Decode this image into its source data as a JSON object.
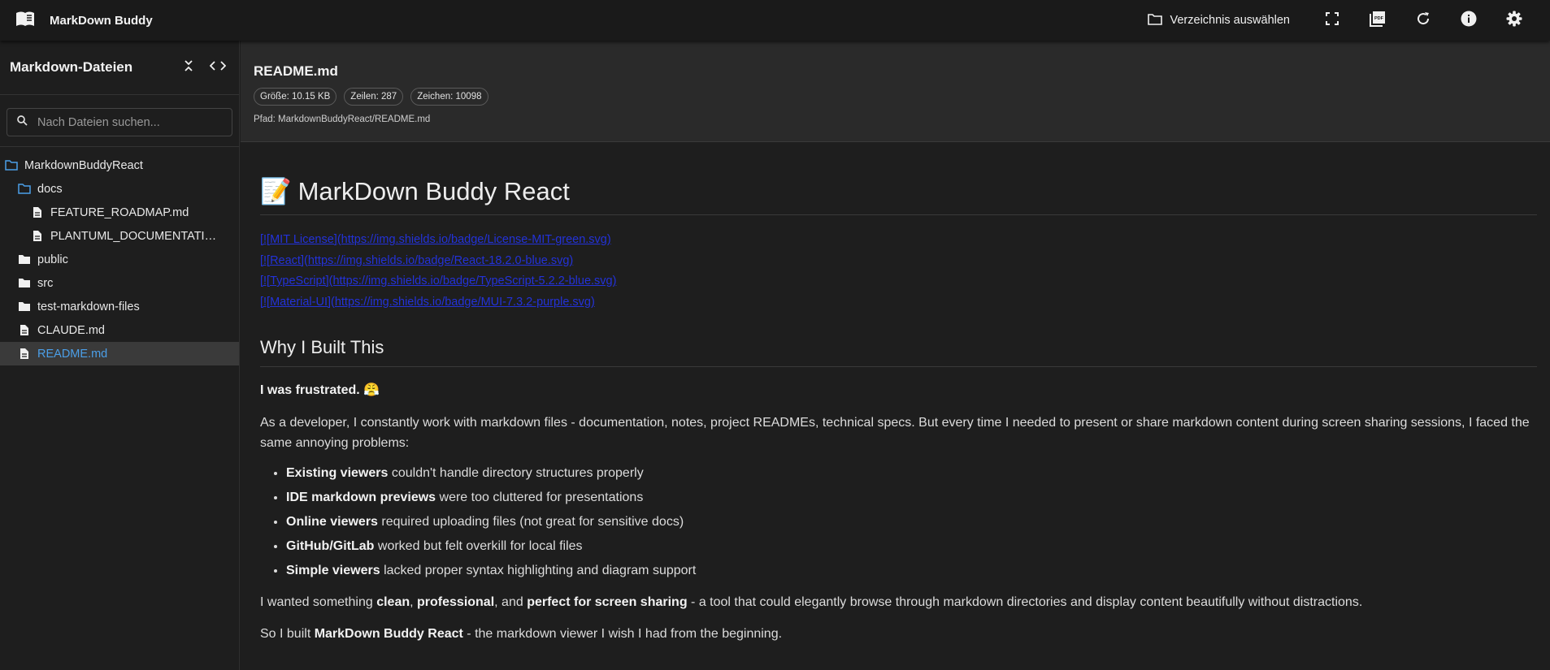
{
  "app": {
    "title": "MarkDown Buddy"
  },
  "toolbar": {
    "select_dir_label": "Verzeichnis auswählen",
    "icons": [
      "folder-icon",
      "fullscreen-icon",
      "pdf-icon",
      "refresh-icon",
      "info-icon",
      "settings-icon"
    ]
  },
  "sidebar": {
    "title": "Markdown-Dateien",
    "search_placeholder": "Nach Dateien suchen...",
    "items": [
      {
        "label": "MarkdownBuddyReact",
        "type": "folder-open",
        "level": 0
      },
      {
        "label": "docs",
        "type": "folder-open",
        "level": 1
      },
      {
        "label": "FEATURE_ROADMAP.md",
        "type": "file",
        "level": 2
      },
      {
        "label": "PLANTUML_DOCUMENTATION.md",
        "type": "file",
        "level": 2
      },
      {
        "label": "public",
        "type": "folder",
        "level": 1
      },
      {
        "label": "src",
        "type": "folder",
        "level": 1
      },
      {
        "label": "test-markdown-files",
        "type": "folder",
        "level": 1
      },
      {
        "label": "CLAUDE.md",
        "type": "file",
        "level": 1
      },
      {
        "label": "README.md",
        "type": "file",
        "level": 1,
        "active": true
      }
    ]
  },
  "file": {
    "name": "README.md",
    "size": "Größe: 10.15 KB",
    "lines": "Zeilen: 287",
    "chars": "Zeichen: 10098",
    "path": "Pfad: MarkdownBuddyReact/README.md"
  },
  "doc": {
    "h1_emoji": "📝",
    "h1": "MarkDown Buddy React",
    "links": [
      "[![MIT License](https://img.shields.io/badge/License-MIT-green.svg)",
      "[![React](https://img.shields.io/badge/React-18.2.0-blue.svg)",
      "[![TypeScript](https://img.shields.io/badge/TypeScript-5.2.2-blue.svg)",
      "[![Material-UI](https://img.shields.io/badge/MUI-7.3.2-purple.svg)"
    ],
    "h2": "Why I Built This",
    "frustrated": "I was frustrated. 😤",
    "intro": "As a developer, I constantly work with markdown files - documentation, notes, project READMEs, technical specs. But every time I needed to present or share markdown content during screen sharing sessions, I faced the same annoying problems:",
    "bullets": [
      {
        "bold": "Existing viewers",
        "text": " couldn't handle directory structures properly"
      },
      {
        "bold": "IDE markdown previews",
        "text": " were too cluttered for presentations"
      },
      {
        "bold": "Online viewers",
        "text": " required uploading files (not great for sensitive docs)"
      },
      {
        "bold": "GitHub/GitLab",
        "text": " worked but felt overkill for local files"
      },
      {
        "bold": "Simple viewers",
        "text": " lacked proper syntax highlighting and diagram support"
      }
    ],
    "wanted": {
      "t1": "I wanted something ",
      "b1": "clean",
      "t2": ", ",
      "b2": "professional",
      "t3": ", and ",
      "b3": "perfect for screen sharing",
      "t4": " - a tool that could elegantly browse through markdown directories and display content beautifully without distractions."
    },
    "built": {
      "t1": "So I built ",
      "b1": "MarkDown Buddy React",
      "t2": " - the markdown viewer I wish I had from the beginning."
    }
  }
}
